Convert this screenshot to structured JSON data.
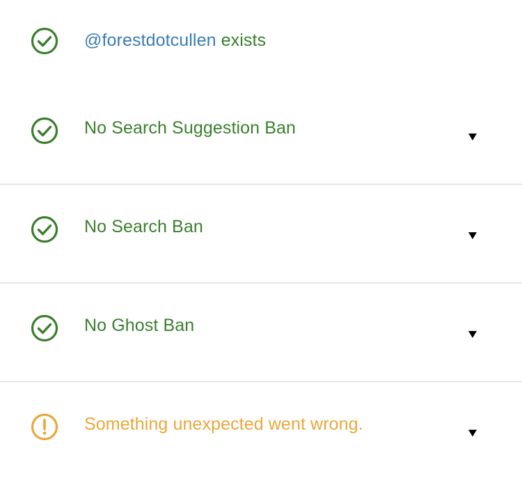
{
  "results": {
    "exists": {
      "handle": "@forestdotcullen",
      "suffix": " exists",
      "icon": "check-circle-icon",
      "status": "ok"
    },
    "items": [
      {
        "label": "No Search Suggestion Ban",
        "icon": "check-circle-icon",
        "status": "ok",
        "expand_icon": "triangle-down-icon"
      },
      {
        "label": "No Search Ban",
        "icon": "check-circle-icon",
        "status": "ok",
        "expand_icon": "triangle-down-icon"
      },
      {
        "label": "No Ghost Ban",
        "icon": "check-circle-icon",
        "status": "ok",
        "expand_icon": "triangle-down-icon"
      },
      {
        "label": "Something unexpected went wrong.",
        "icon": "exclamation-circle-icon",
        "status": "warning",
        "expand_icon": "triangle-down-icon"
      }
    ]
  },
  "colors": {
    "ok": "#3a7f2c",
    "warning": "#eba63a",
    "link": "#3a7cb4",
    "divider": "#e3e6ea"
  }
}
